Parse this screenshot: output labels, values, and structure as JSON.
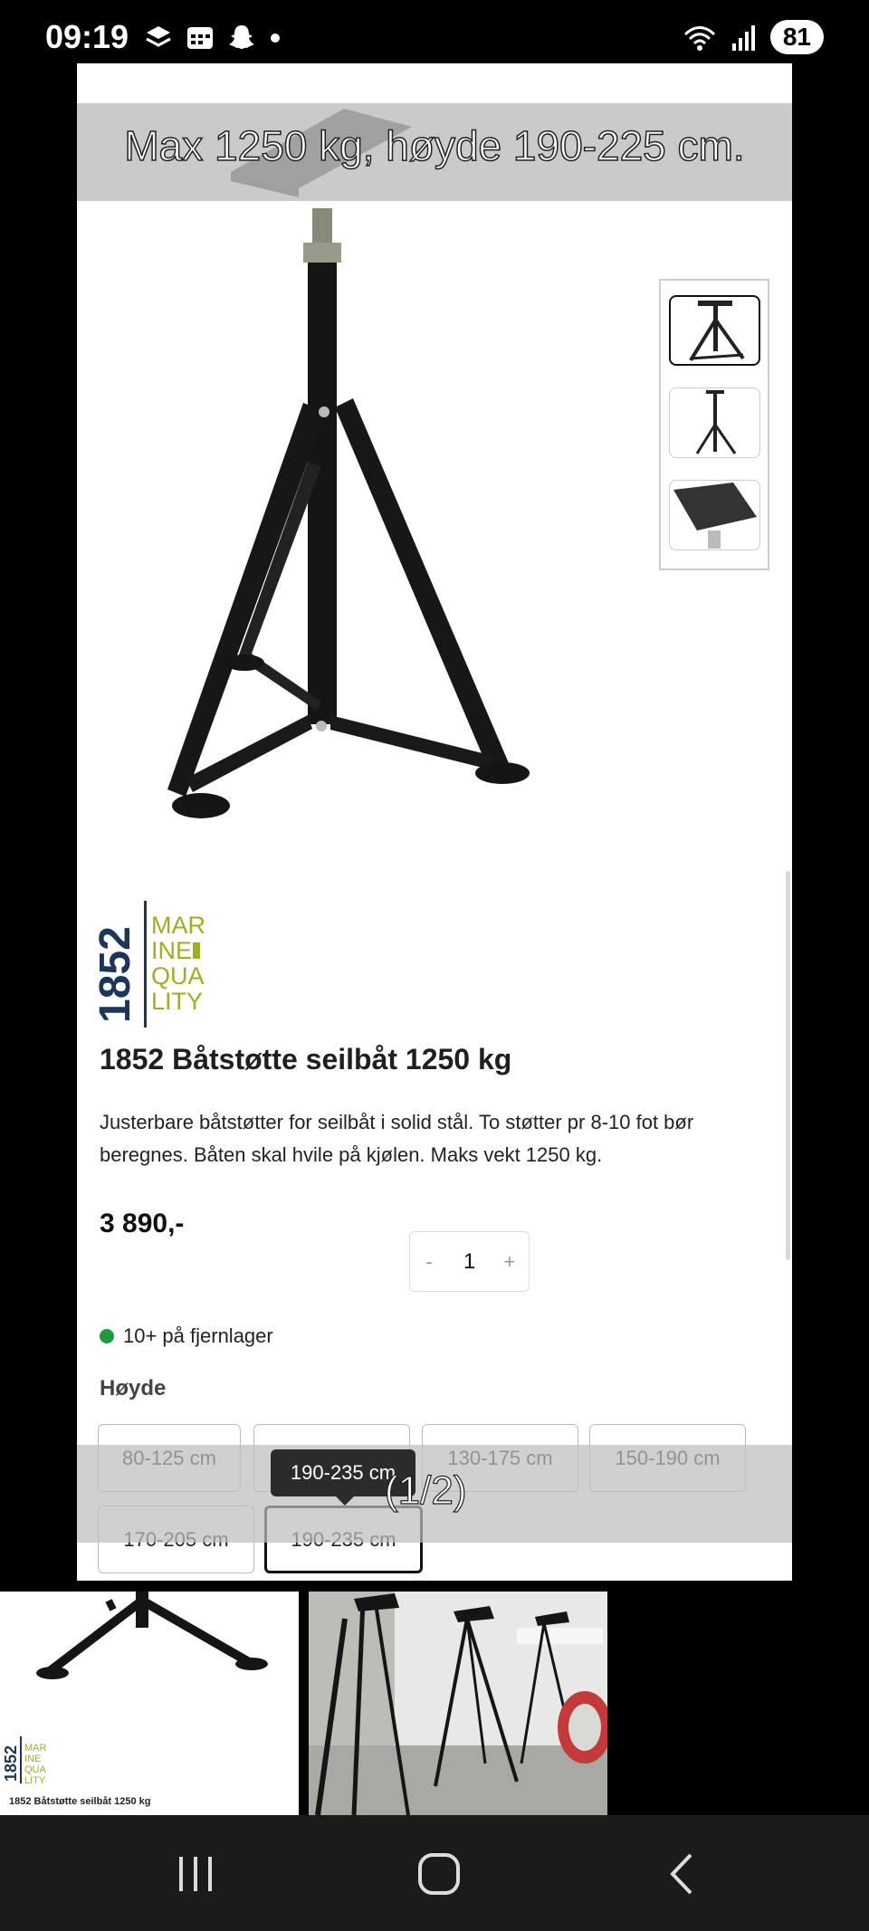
{
  "status_bar": {
    "time": "09:19",
    "battery": "81",
    "left_icons": [
      "layers-icon",
      "calendar-icon",
      "snapchat-icon",
      "dot-icon"
    ],
    "right_icons": [
      "wifi-icon",
      "signal-icon"
    ]
  },
  "media": {
    "caption": "Max 1250 kg, høyde 190-225 cm.",
    "counter": "(1/2)",
    "thumbnails": [
      "stand-full-icon",
      "stand-tall-icon",
      "stand-pad-icon"
    ]
  },
  "brand": {
    "number": "1852",
    "lines": [
      "MAR",
      "INE",
      "QUA",
      "LITY"
    ]
  },
  "product": {
    "title": "1852 Båtstøtte seilbåt 1250 kg",
    "description": "Justerbare båtstøtter for seilbåt i solid stål. To støtter pr 8-10 fot bør beregnes. Båten skal hvile på kjølen. Maks vekt 1250 kg.",
    "price": "3 890,-",
    "quantity": {
      "minus": "-",
      "value": "1",
      "plus": "+"
    },
    "stock": "10+ på fjernlager",
    "option_label": "Høyde",
    "options": [
      "80-125 cm",
      "190-235 cm",
      "130-175 cm",
      "150-190 cm",
      "170-205 cm",
      "190-235 cm"
    ],
    "selected_option": "190-235 cm",
    "tooltip": "190-235 cm"
  },
  "gallery": {
    "caption": "1852 Båtstøtte seilbåt 1250 kg"
  },
  "colors": {
    "stock_green": "#1d9b3a",
    "brand_navy": "#1c3558",
    "brand_olive": "#9fae24"
  }
}
